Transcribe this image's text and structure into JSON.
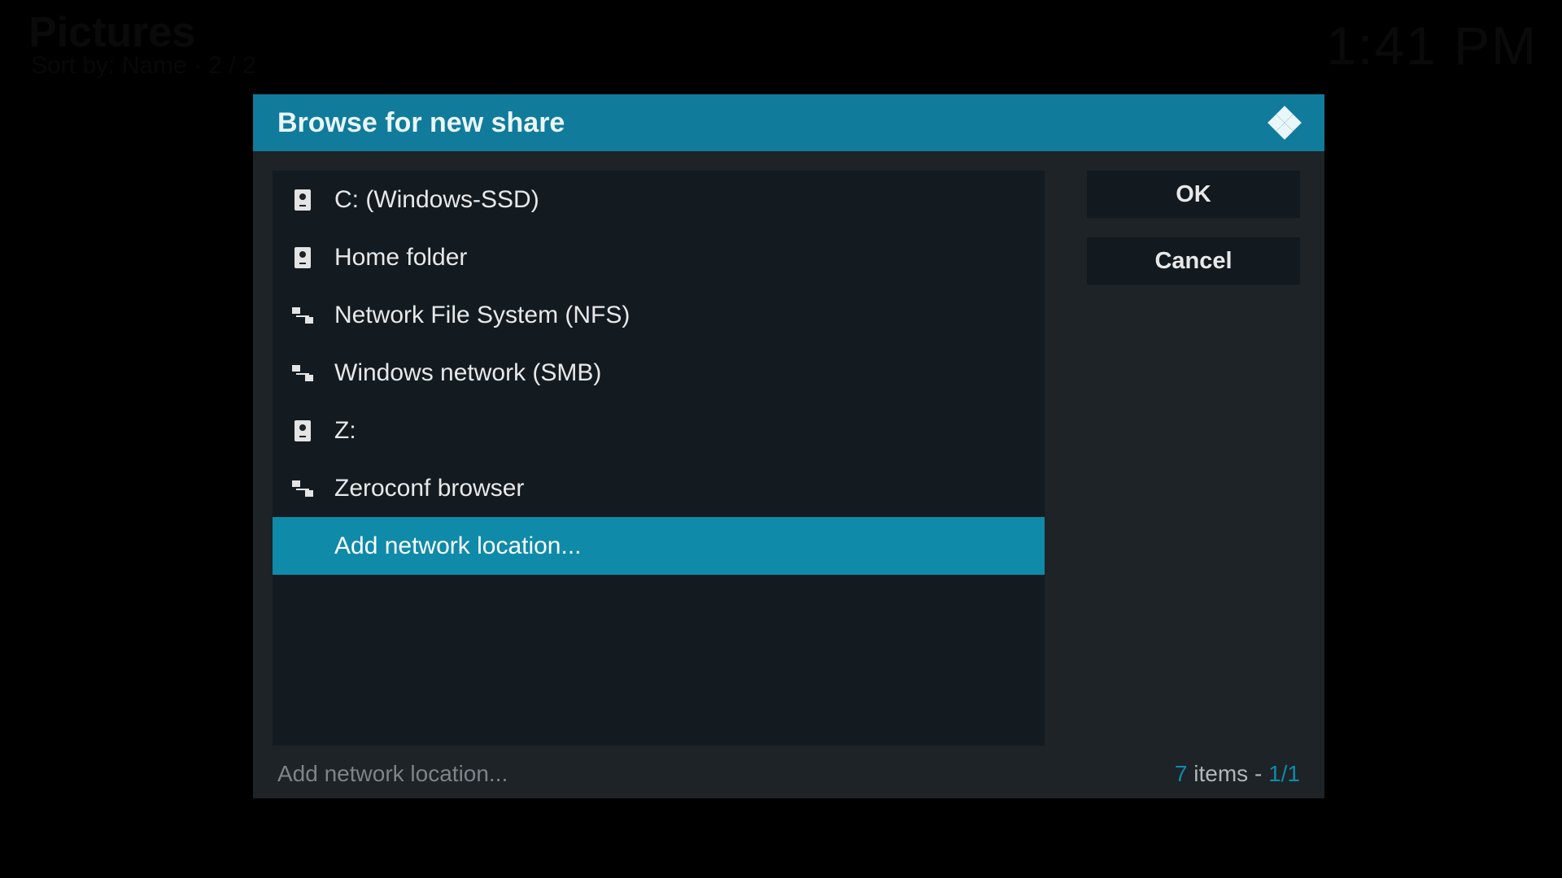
{
  "background": {
    "section_title": "Pictures",
    "subtitle": "Sort by: Name  ·  2 / 2",
    "clock": "1:41 PM"
  },
  "dialog": {
    "title": "Browse for new share",
    "items": [
      {
        "label": "C: (Windows-SSD)",
        "icon": "drive",
        "selected": false
      },
      {
        "label": "Home folder",
        "icon": "drive",
        "selected": false
      },
      {
        "label": "Network File System (NFS)",
        "icon": "network",
        "selected": false
      },
      {
        "label": "Windows network (SMB)",
        "icon": "network",
        "selected": false
      },
      {
        "label": "Z:",
        "icon": "drive",
        "selected": false
      },
      {
        "label": "Zeroconf browser",
        "icon": "network",
        "selected": false
      },
      {
        "label": "Add network location...",
        "icon": "",
        "selected": true
      }
    ],
    "buttons": {
      "ok": "OK",
      "cancel": "Cancel"
    },
    "footer": {
      "path": "Add network location...",
      "count_prefix": "7",
      "count_word": " items - ",
      "page": "1/1"
    }
  },
  "colors": {
    "accent": "#0f8aa9",
    "header": "#117b9b",
    "panel": "#131b21",
    "dialog_bg": "#1d2327"
  }
}
